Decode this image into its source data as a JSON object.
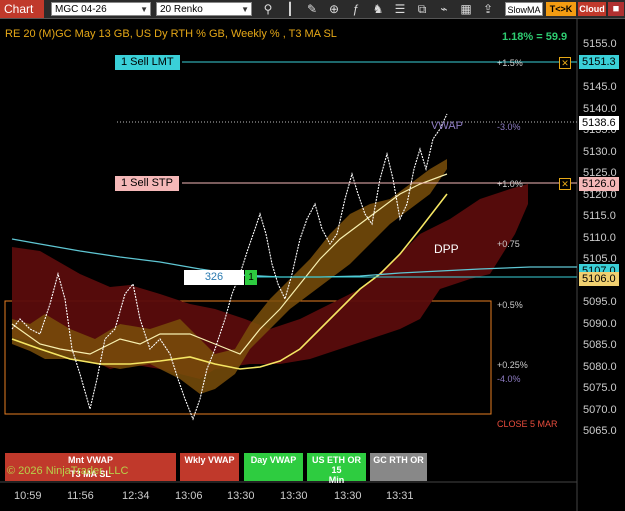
{
  "toolbar": {
    "tab_label": "Chart",
    "instrument": "MGC 04-26",
    "period": "20 Renko",
    "icons": [
      "magnifier-icon",
      "bar-style-icon",
      "drawing-tool-icon",
      "zoom-in-icon",
      "indicators-icon",
      "strategies-icon",
      "properties-icon",
      "window-linking-icon",
      "attach-icon",
      "data-box-icon",
      "alert-icon",
      "share-icon"
    ],
    "slowma_label": "SlowMA",
    "tk_label": "T<>K",
    "cloud_label": "Cloud",
    "close_label": "■"
  },
  "chart": {
    "title": "RE 20  (M)GC May 13 GB, US Dy RTH % GB, Weekly % , T3 MA SL",
    "perf": "1.18% = 59.9",
    "price_ticks": [
      "5155.0",
      "5150.0",
      "5145.0",
      "5140.0",
      "5135.0",
      "5130.0",
      "5125.0",
      "5120.0",
      "5115.0",
      "5110.0",
      "5105.0",
      "5100.0",
      "5095.0",
      "5090.0",
      "5085.0",
      "5080.0",
      "5075.0",
      "5070.0",
      "5065.0"
    ],
    "time_ticks": [
      "10:59",
      "11:56",
      "12:34",
      "13:06",
      "13:30",
      "13:30",
      "13:30",
      "13:31"
    ],
    "price_boxes": [
      {
        "value": "5151.3",
        "bg": "#3ad0d8",
        "fg": "#000"
      },
      {
        "value": "5138.6",
        "bg": "#ffffff",
        "fg": "#000"
      },
      {
        "value": "5126.0",
        "bg": "#f5b8b8",
        "fg": "#000"
      },
      {
        "value": "5107.0",
        "bg": "#3ad0d8",
        "fg": "#000"
      },
      {
        "value": "5106.0",
        "bg": "#f0d070",
        "fg": "#000"
      }
    ],
    "orders": {
      "limit_label": "1 Sell LMT",
      "stop_label": "1 Sell STP",
      "x_mark": "✕"
    },
    "level_labels": {
      "p15": "+1.5%",
      "m30": "-3.0%",
      "p10": "+1.0%",
      "p075": "+0.75",
      "p05": "+0.5%",
      "p025": "+0.25%",
      "m40": "-4.0%"
    },
    "position": {
      "qty": "326",
      "flag": "1"
    },
    "dpp": "DPP",
    "vwap_top": "VWAP",
    "close_label": "CLOSE 5 MAR",
    "copyright": "© 2026 NinjaTrader, LLC"
  },
  "vwap_buttons": [
    {
      "line1": "Mnt VWAP",
      "line2": "T3 MA SL",
      "bg": "#c0392b",
      "fg": "#fff"
    },
    {
      "line1": "Wkly VWAP",
      "line2": "",
      "bg": "#c0392b",
      "fg": "#fff"
    },
    {
      "line1": "Day VWAP",
      "line2": "",
      "bg": "#2ecc40",
      "fg": "#fff"
    },
    {
      "line1": "US ETH OR 15",
      "line2": "Min",
      "bg": "#2ecc40",
      "fg": "#fff"
    },
    {
      "line1": "GC RTH OR",
      "line2": "",
      "bg": "#888888",
      "fg": "#fff"
    }
  ],
  "colors": {
    "accent": "#e6a817",
    "positive": "#2ecc71",
    "cloud_red": "#6b0f0f",
    "cloud_orange": "#8a5a10"
  }
}
